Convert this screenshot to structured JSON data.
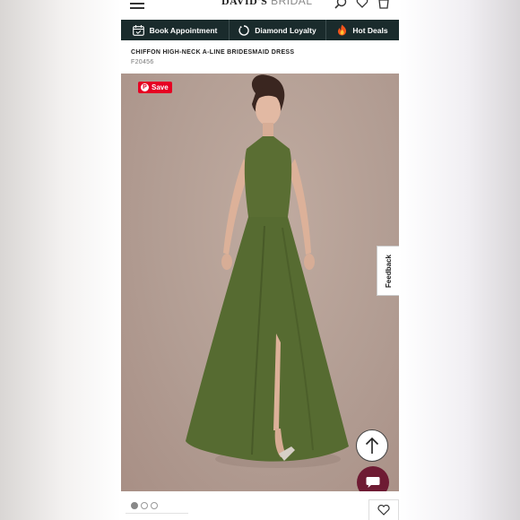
{
  "header": {
    "logo_primary": "DAVID'S",
    "logo_secondary": "BRIDAL",
    "icons": [
      "menu-icon",
      "search-icon",
      "heart-icon",
      "bag-icon"
    ]
  },
  "navbar": {
    "items": [
      {
        "label": "Book Appointment",
        "icon": "calendar-icon"
      },
      {
        "label": "Diamond Loyalty",
        "icon": "loyalty-ring-icon"
      },
      {
        "label": "Hot Deals",
        "icon": "flame-icon"
      }
    ]
  },
  "product": {
    "title": "CHIFFON HIGH-NECK A-LINE BRIDESMAID DRESS",
    "sku": "F20456"
  },
  "image": {
    "pinterest_label": "Save",
    "dress_color": "#566b31",
    "background_color": "#b5a096"
  },
  "feedback": {
    "label": "Feedback"
  },
  "carousel": {
    "count": 3,
    "active_index": 0
  },
  "colors": {
    "navbar_bg": "#1a2b2c",
    "chat_button": "#6e1b33",
    "pinterest_red": "#e60023"
  }
}
